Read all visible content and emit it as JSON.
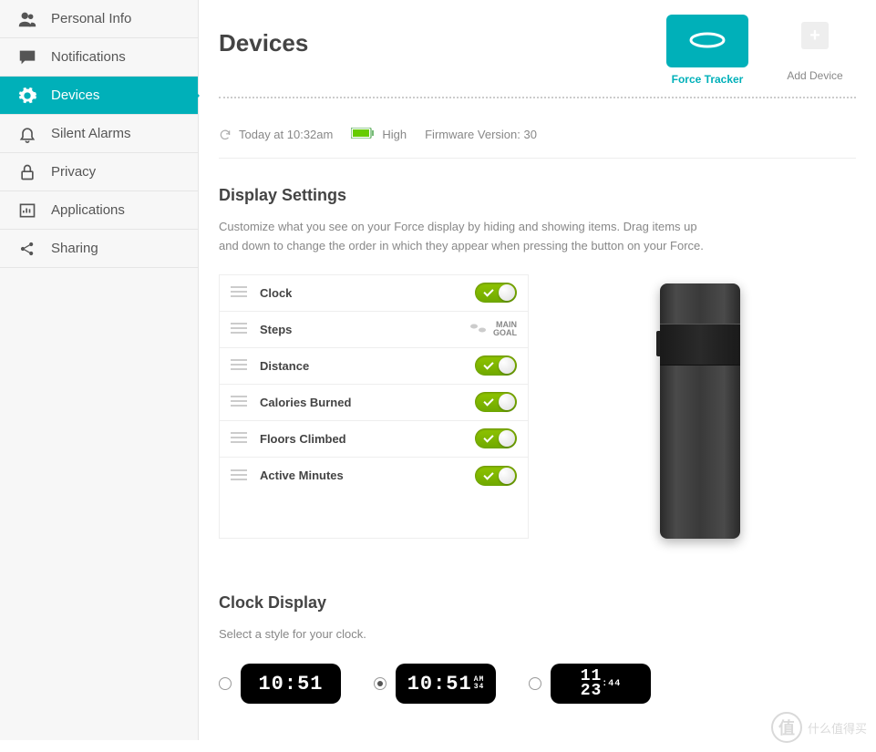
{
  "page_title": "Devices",
  "sidebar": {
    "items": [
      {
        "label": "Personal Info",
        "icon": "people-icon"
      },
      {
        "label": "Notifications",
        "icon": "speech-icon"
      },
      {
        "label": "Devices",
        "icon": "gear-icon",
        "active": true
      },
      {
        "label": "Silent Alarms",
        "icon": "bell-icon"
      },
      {
        "label": "Privacy",
        "icon": "lock-icon"
      },
      {
        "label": "Applications",
        "icon": "chart-icon"
      },
      {
        "label": "Sharing",
        "icon": "share-icon"
      }
    ]
  },
  "device_tabs": {
    "active": {
      "label": "Force Tracker"
    },
    "add": {
      "label": "Add Device"
    }
  },
  "status": {
    "sync_time": "Today at 10:32am",
    "battery": "High",
    "firmware": "Firmware Version: 30"
  },
  "display_settings": {
    "title": "Display Settings",
    "description": "Customize what you see on your Force display by hiding and showing items. Drag items up and down to change the order in which they appear when pressing the button on your Force.",
    "items": [
      {
        "label": "Clock",
        "on": true
      },
      {
        "label": "Steps",
        "main_goal": true,
        "goal_text_1": "MAIN",
        "goal_text_2": "GOAL"
      },
      {
        "label": "Distance",
        "on": true
      },
      {
        "label": "Calories Burned",
        "on": true
      },
      {
        "label": "Floors Climbed",
        "on": true
      },
      {
        "label": "Active Minutes",
        "on": true
      }
    ]
  },
  "clock_display": {
    "title": "Clock Display",
    "description": "Select a style for your clock.",
    "options": [
      {
        "time": "10:51",
        "selected": false
      },
      {
        "time": "10:51",
        "ampm": "AM",
        "sec": "34",
        "selected": true
      },
      {
        "line1": "11",
        "line2": "23",
        "sec": ":44",
        "selected": false
      }
    ]
  },
  "watermark": {
    "text": "什么值得买",
    "badge": "值"
  }
}
